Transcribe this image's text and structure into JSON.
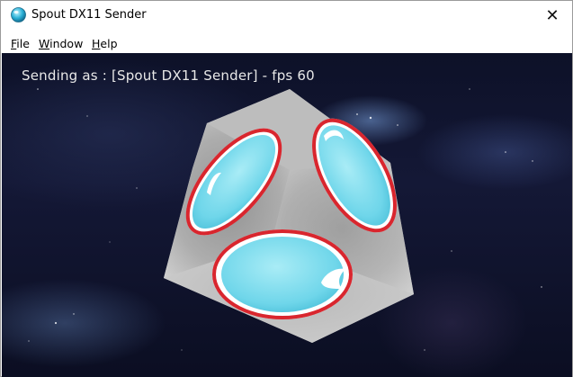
{
  "window": {
    "title": "Spout DX11 Sender",
    "close_glyph": "✕"
  },
  "menu": {
    "items": [
      {
        "label_u": "F",
        "label_rest": "ile"
      },
      {
        "label_u": "W",
        "label_rest": "indow"
      },
      {
        "label_u": "H",
        "label_rest": "elp"
      }
    ]
  },
  "canvas": {
    "status_text": "Sending as : [Spout DX11 Sender] - fps 60",
    "background_colors": [
      "#0d1128",
      "#141836"
    ],
    "cube_face_color": "#9b9b9b",
    "bubble_color": "#7fdcee",
    "ring_color": "#d9262e"
  },
  "icons": {
    "app_icon": "spout-logo-icon",
    "close_icon": "close-icon"
  }
}
